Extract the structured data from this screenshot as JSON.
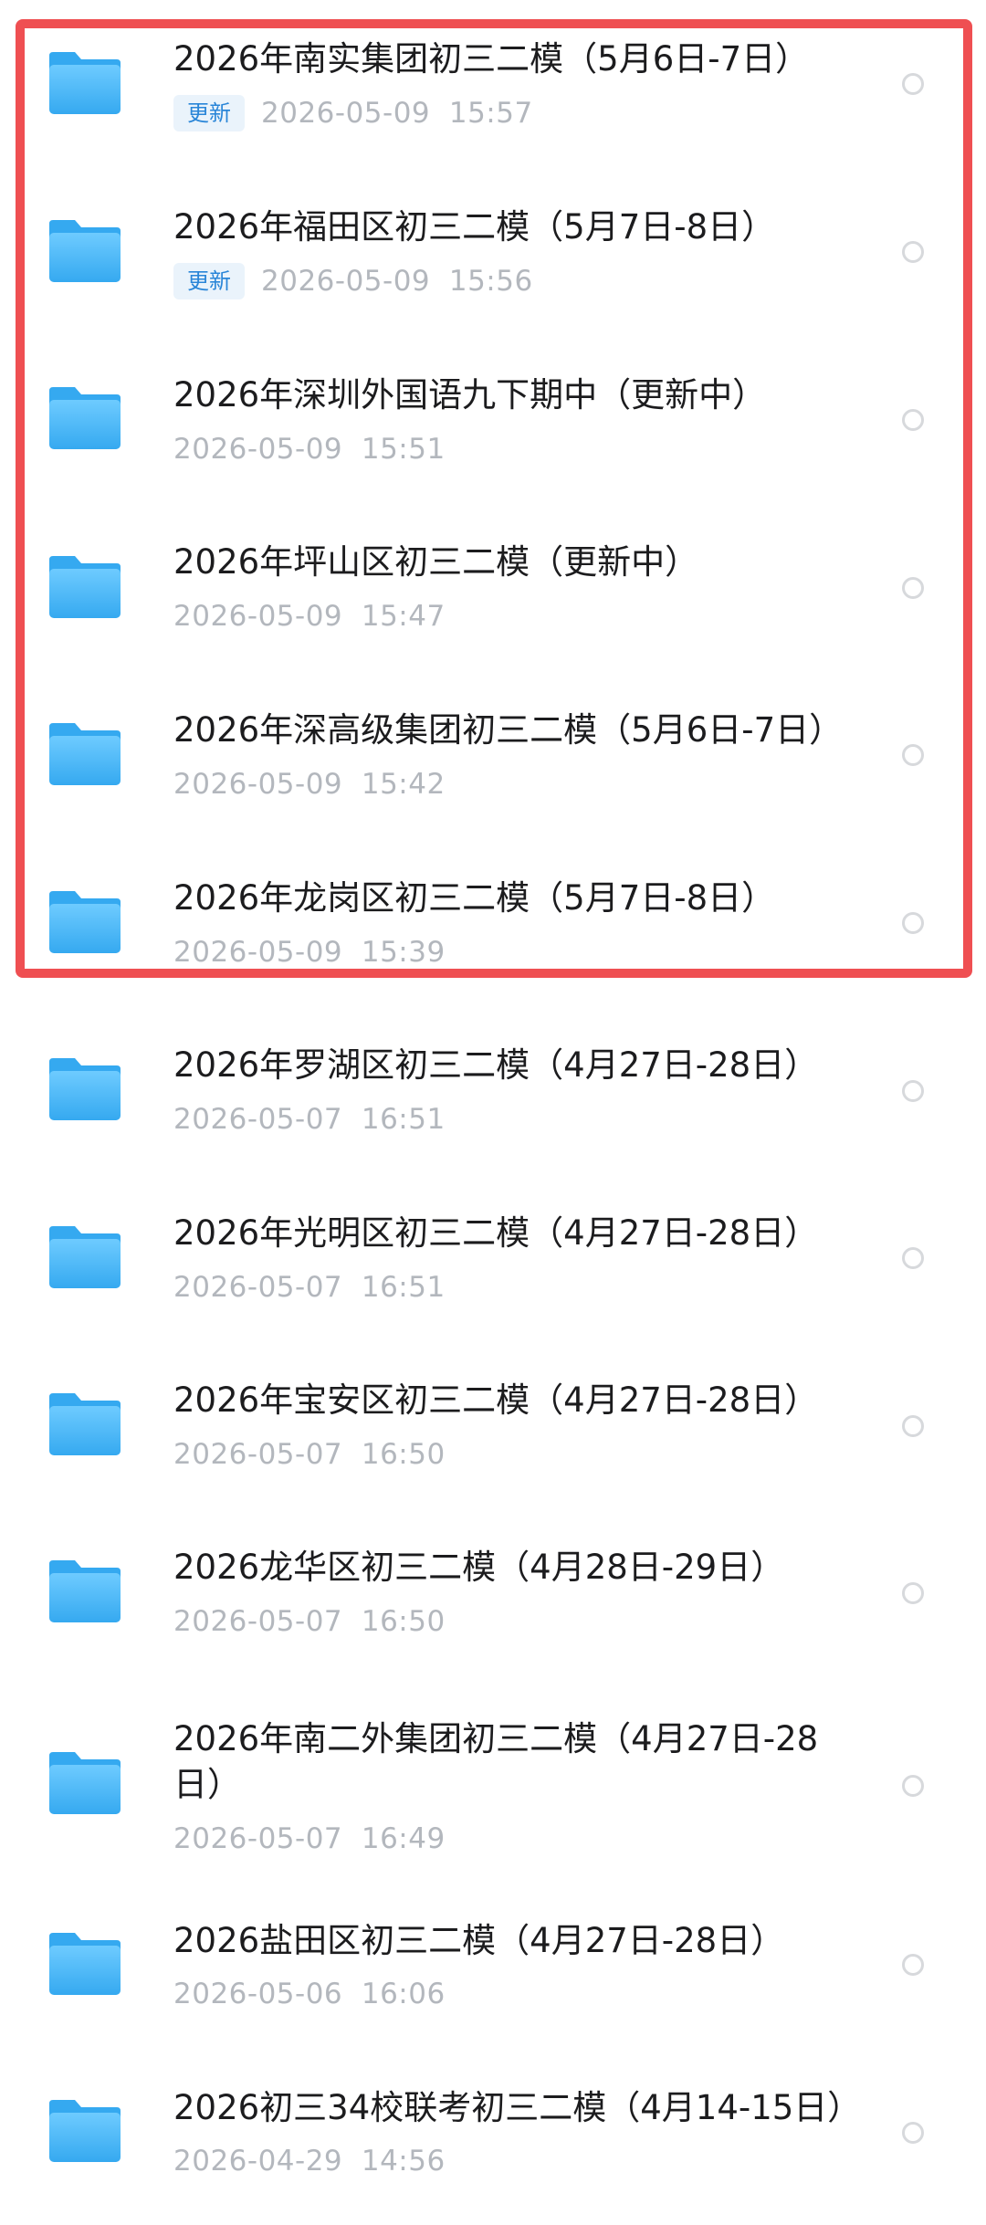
{
  "files": [
    {
      "name": "2026年南实集团初三二模（5月6日-7日）",
      "badge": "更新",
      "modified": "2026-05-09  15:57"
    },
    {
      "name": "2026年福田区初三二模（5月7日-8日）",
      "badge": "更新",
      "modified": "2026-05-09  15:56"
    },
    {
      "name": "2026年深圳外国语九下期中（更新中）",
      "badge": "",
      "modified": "2026-05-09  15:51"
    },
    {
      "name": "2026年坪山区初三二模（更新中）",
      "badge": "",
      "modified": "2026-05-09  15:47"
    },
    {
      "name": "2026年深高级集团初三二模（5月6日-7日）",
      "badge": "",
      "modified": "2026-05-09  15:42"
    },
    {
      "name": "2026年龙岗区初三二模（5月7日-8日）",
      "badge": "",
      "modified": "2026-05-09  15:39"
    },
    {
      "name": "2026年罗湖区初三二模（4月27日-28日）",
      "badge": "",
      "modified": "2026-05-07  16:51"
    },
    {
      "name": "2026年光明区初三二模（4月27日-28日）",
      "badge": "",
      "modified": "2026-05-07  16:51"
    },
    {
      "name": "2026年宝安区初三二模（4月27日-28日）",
      "badge": "",
      "modified": "2026-05-07  16:50"
    },
    {
      "name": "2026龙华区初三二模（4月28日-29日）",
      "badge": "",
      "modified": "2026-05-07  16:50"
    },
    {
      "name": "2026年南二外集团初三二模（4月27日-28日）",
      "badge": "",
      "modified": "2026-05-07  16:49"
    },
    {
      "name": "2026盐田区初三二模（4月27日-28日）",
      "badge": "",
      "modified": "2026-05-06  16:06"
    },
    {
      "name": "2026初三34校联考初三二模（4月14-15日）",
      "badge": "",
      "modified": "2026-04-29  14:56"
    }
  ],
  "icons": {
    "folder": "folder-icon",
    "select": "radio-circle"
  },
  "colors": {
    "folder_light": "#6ecbff",
    "folder_dark": "#35a9f0",
    "badge_bg": "#eaf3fb",
    "badge_text": "#2a86d8",
    "highlight": "#ef4f52",
    "timestamp": "#b3b7bd"
  }
}
